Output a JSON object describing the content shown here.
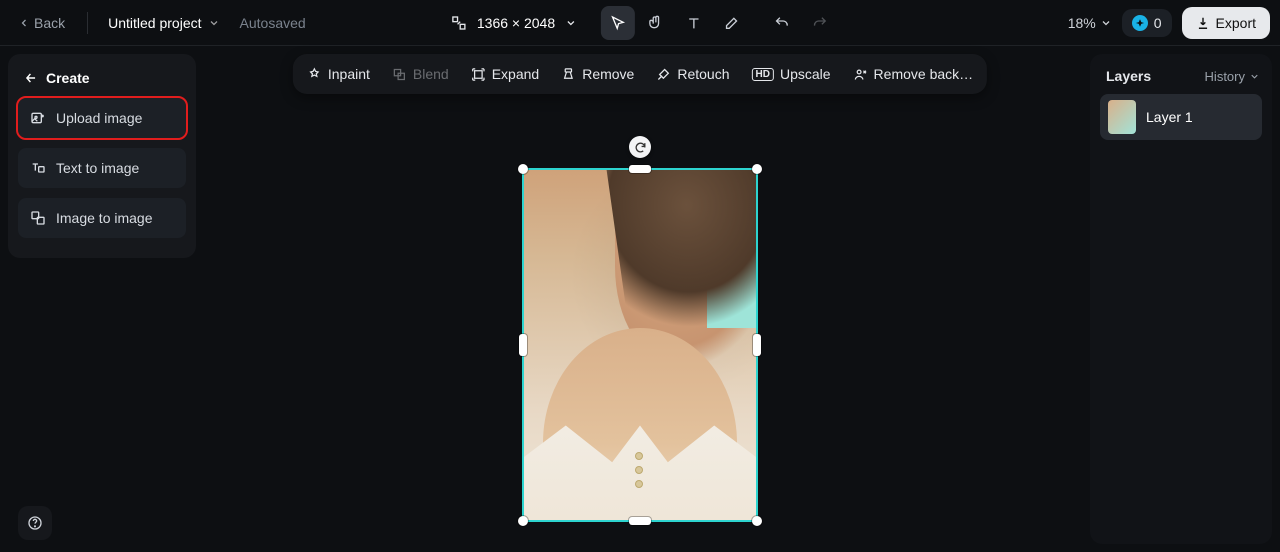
{
  "header": {
    "back": "Back",
    "project_name": "Untitled project",
    "autosaved": "Autosaved",
    "dimensions": "1366 × 2048",
    "zoom": "18%",
    "credits": "0",
    "export": "Export"
  },
  "create_panel": {
    "title": "Create",
    "items": [
      {
        "label": "Upload image"
      },
      {
        "label": "Text to image"
      },
      {
        "label": "Image to image"
      }
    ]
  },
  "canvas_toolbar": {
    "inpaint": "Inpaint",
    "blend": "Blend",
    "expand": "Expand",
    "remove": "Remove",
    "retouch": "Retouch",
    "upscale": "Upscale",
    "remove_bg": "Remove back…"
  },
  "layers_panel": {
    "title": "Layers",
    "history": "History",
    "layers": [
      {
        "name": "Layer 1"
      }
    ]
  }
}
